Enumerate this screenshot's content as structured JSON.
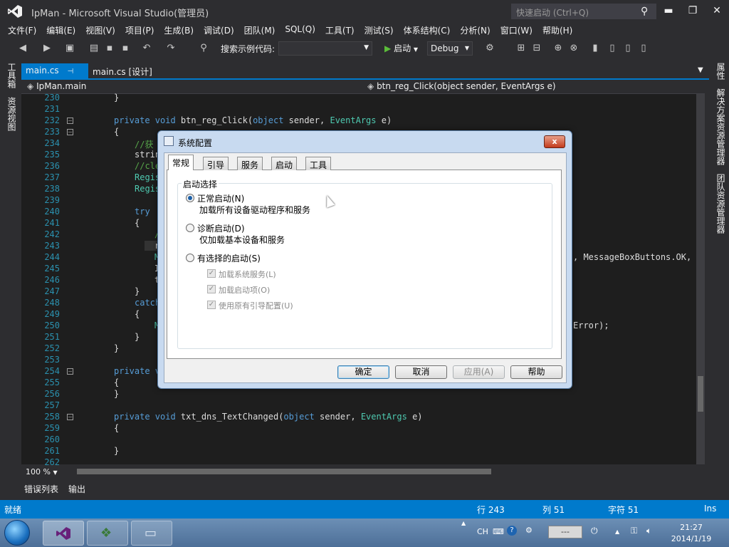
{
  "window": {
    "title": "IpMan - Microsoft Visual Studio(管理员)",
    "quick_launch_placeholder": "快速启动 (Ctrl+Q)",
    "minimize": "▬",
    "maximize": "❐",
    "close": "✕"
  },
  "menu": [
    "文件(F)",
    "编辑(E)",
    "视图(V)",
    "项目(P)",
    "生成(B)",
    "调试(D)",
    "团队(M)",
    "SQL(Q)",
    "工具(T)",
    "测试(S)",
    "体系结构(C)",
    "分析(N)",
    "窗口(W)",
    "帮助(H)"
  ],
  "toolbar": {
    "search_label": "搜索示例代码:",
    "start_label": "启动",
    "config": "Debug"
  },
  "left_panel": {
    "toolbox": "工具箱",
    "resources": "资源视图"
  },
  "right_panel": {
    "properties": "属性",
    "solution_explorer": "解决方案资源管理器",
    "team_explorer": "团队资源管理器"
  },
  "tabs": {
    "main": "main.cs",
    "design": "main.cs [设计]"
  },
  "navbar": {
    "left": "IpMan.main",
    "right": "btn_reg_Click(object sender, EventArgs e)"
  },
  "code": {
    "lines": [
      "230",
      "231",
      "232",
      "233",
      "234",
      "235",
      "236",
      "237",
      "238",
      "239",
      "240",
      "241",
      "242",
      "243",
      "244",
      "245",
      "246",
      "247",
      "248",
      "249",
      "250",
      "251",
      "252",
      "253",
      "254",
      "255",
      "256",
      "257",
      "258",
      "259",
      "260",
      "261",
      "262"
    ],
    "l230": "}",
    "l232_kw": "private void",
    "l232_name": " btn_reg_Click(",
    "l232_obj": "object",
    "l232_sender": " sender, ",
    "l232_ty": "EventArgs",
    "l232_e": " e)",
    "l233": "{",
    "l234": "//获",
    "l235": "strin",
    "l236": "//cle",
    "l237": "Regis",
    "l238": "Regis",
    "l240": "try",
    "l241": "{",
    "l242": "/",
    "l243": "r",
    "l244": "M",
    "l244_right": ", MessageBoxButtons.OK, M",
    "l245": "I",
    "l246": "t",
    "l247": "}",
    "l248": "catch",
    "l249": "{",
    "l250": "M",
    "l250_right": "Error);",
    "l251": "}",
    "l252": "}",
    "l254": "private v",
    "l255": "{",
    "l256": "}",
    "l258_kw": "private void",
    "l258_name": " txt_dns_TextChanged(",
    "l258_obj": "object",
    "l258_sender": " sender, ",
    "l258_ty": "EventArgs",
    "l258_e": " e)",
    "l259": "{",
    "l261": "}"
  },
  "zoom": "100 %",
  "bottom_tabs": [
    "错误列表",
    "输出"
  ],
  "status": {
    "ready": "就绪",
    "row": "行 243",
    "col": "列 51",
    "char": "字符 51",
    "mode": "Ins"
  },
  "taskbar": {
    "ime": "CH",
    "time": "21:27",
    "date": "2014/1/19",
    "battery": "---"
  },
  "dialog": {
    "title": "系统配置",
    "close": "x",
    "tabs": [
      "常规",
      "引导",
      "服务",
      "启动",
      "工具"
    ],
    "group": "启动选择",
    "normal_label": "正常启动(N)",
    "normal_desc": "加载所有设备驱动程序和服务",
    "diag_label": "诊断启动(D)",
    "diag_desc": "仅加载基本设备和服务",
    "selective_label": "有选择的启动(S)",
    "opt_services": "加载系统服务(L)",
    "opt_startup": "加载启动项(O)",
    "opt_boot": "使用原有引导配置(U)",
    "ok": "确定",
    "cancel": "取消",
    "apply": "应用(A)",
    "help": "帮助"
  }
}
